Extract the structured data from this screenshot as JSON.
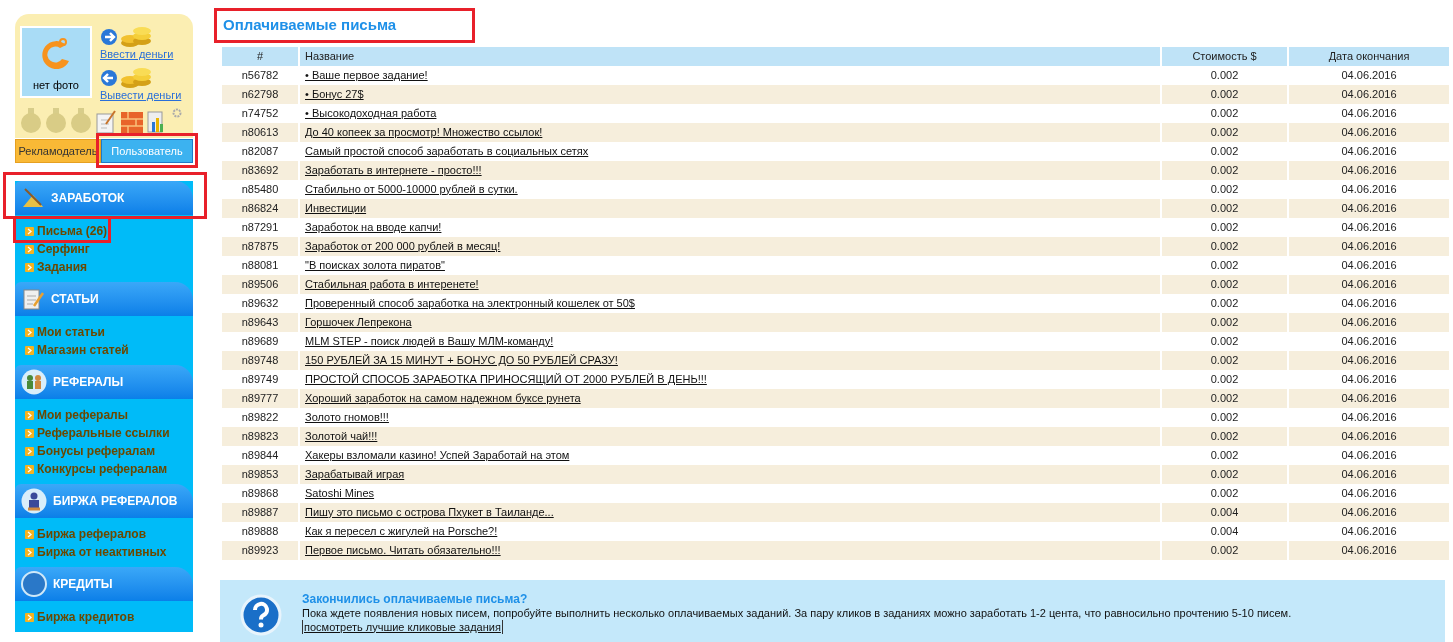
{
  "profile": {
    "photo_label": "нет фото",
    "actions": [
      {
        "kind": "deposit",
        "label": "Ввести деньги"
      },
      {
        "kind": "withdraw",
        "label": "Вывести деньги"
      }
    ],
    "modes": [
      {
        "label": "Рекламодатель",
        "selected": false,
        "highlighted": false
      },
      {
        "label": "Пользователь",
        "selected": true,
        "highlighted": true
      }
    ]
  },
  "menu": [
    {
      "kind": "earnings",
      "title": "ЗАРАБОТОК",
      "highlighted": true,
      "items": [
        {
          "label": "Письма (26)",
          "highlighted": true
        },
        {
          "label": "Серфинг",
          "highlighted": false
        },
        {
          "label": "Задания",
          "highlighted": false
        }
      ]
    },
    {
      "kind": "articles",
      "title": "СТАТЬИ",
      "highlighted": false,
      "items": [
        {
          "label": "Мои статьи",
          "highlighted": false
        },
        {
          "label": "Магазин статей",
          "highlighted": false
        }
      ]
    },
    {
      "kind": "referrals",
      "title": "РЕФЕРАЛЫ",
      "highlighted": false,
      "items": [
        {
          "label": "Мои рефералы",
          "highlighted": false
        },
        {
          "label": "Реферальные ссылки",
          "highlighted": false
        },
        {
          "label": "Бонусы рефералам",
          "highlighted": false
        },
        {
          "label": "Конкурсы рефералам",
          "highlighted": false
        }
      ]
    },
    {
      "kind": "exchange",
      "title": "БИРЖА РЕФЕРАЛОВ",
      "highlighted": false,
      "items": [
        {
          "label": "Биржа рефералов",
          "highlighted": false
        },
        {
          "label": "Биржа от неактивных",
          "highlighted": false
        }
      ]
    },
    {
      "kind": "credits",
      "title": "КРЕДИТЫ",
      "highlighted": false,
      "items": [
        {
          "label": "Биржа кредитов",
          "highlighted": false
        }
      ]
    }
  ],
  "page_title": {
    "text": "Оплачиваемые письма",
    "highlighted": true
  },
  "table": {
    "columns": [
      "#",
      "Название",
      "Стоимость $",
      "Дата окончания"
    ],
    "rows": [
      {
        "id": "n56782",
        "title": "• Ваше первое задание!",
        "cost": "0.002",
        "end_date": "04.06.2016"
      },
      {
        "id": "n62798",
        "title": "• Бонус 27$",
        "cost": "0.002",
        "end_date": "04.06.2016"
      },
      {
        "id": "n74752",
        "title": "• Высокодоходная работа",
        "cost": "0.002",
        "end_date": "04.06.2016"
      },
      {
        "id": "n80613",
        "title": "До 40 копеек за просмотр! Множество ссылок!",
        "cost": "0.002",
        "end_date": "04.06.2016"
      },
      {
        "id": "n82087",
        "title": "Самый простой способ заработать в социальных сетях",
        "cost": "0.002",
        "end_date": "04.06.2016"
      },
      {
        "id": "n83692",
        "title": "Заработать в интернете - просто!!!",
        "cost": "0.002",
        "end_date": "04.06.2016"
      },
      {
        "id": "n85480",
        "title": "Стабильно от 5000-10000 рублей в сутки.",
        "cost": "0.002",
        "end_date": "04.06.2016"
      },
      {
        "id": "n86824",
        "title": "Инвестиции",
        "cost": "0.002",
        "end_date": "04.06.2016"
      },
      {
        "id": "n87291",
        "title": "Заработок на вводе капчи!",
        "cost": "0.002",
        "end_date": "04.06.2016"
      },
      {
        "id": "n87875",
        "title": "Заработок от 200 000 рублей в месяц!",
        "cost": "0.002",
        "end_date": "04.06.2016"
      },
      {
        "id": "n88081",
        "title": "\"В поисках золота пиратов\"",
        "cost": "0.002",
        "end_date": "04.06.2016"
      },
      {
        "id": "n89506",
        "title": "Стабильная работа в интеренете!",
        "cost": "0.002",
        "end_date": "04.06.2016"
      },
      {
        "id": "n89632",
        "title": "Проверенный способ заработка на электронный кошелек от 50$",
        "cost": "0.002",
        "end_date": "04.06.2016"
      },
      {
        "id": "n89643",
        "title": "Горшочек Лепрекона",
        "cost": "0.002",
        "end_date": "04.06.2016"
      },
      {
        "id": "n89689",
        "title": "MLM STEP - поиск людей в Вашу МЛМ-команду!",
        "cost": "0.002",
        "end_date": "04.06.2016"
      },
      {
        "id": "n89748",
        "title": "150 РУБЛЕЙ ЗА 15 МИНУТ + БОНУС ДО 50 РУБЛЕЙ СРАЗУ!",
        "cost": "0.002",
        "end_date": "04.06.2016"
      },
      {
        "id": "n89749",
        "title": "ПРОСТОЙ СПОСОБ ЗАРАБОТКА ПРИНОСЯЩИЙ ОТ 2000 РУБЛЕЙ В ДЕНЬ!!!",
        "cost": "0.002",
        "end_date": "04.06.2016"
      },
      {
        "id": "n89777",
        "title": "Хороший заработок на самом надежном буксе рунета",
        "cost": "0.002",
        "end_date": "04.06.2016"
      },
      {
        "id": "n89822",
        "title": "Золото гномов!!!",
        "cost": "0.002",
        "end_date": "04.06.2016"
      },
      {
        "id": "n89823",
        "title": "Золотой чай!!!",
        "cost": "0.002",
        "end_date": "04.06.2016"
      },
      {
        "id": "n89844",
        "title": "Хакеры взломали казино! Успей Заработай на этом",
        "cost": "0.002",
        "end_date": "04.06.2016"
      },
      {
        "id": "n89853",
        "title": "Зарабатывай играя",
        "cost": "0.002",
        "end_date": "04.06.2016"
      },
      {
        "id": "n89868",
        "title": "Satoshi Mines",
        "cost": "0.002",
        "end_date": "04.06.2016"
      },
      {
        "id": "n89887",
        "title": "Пишу это письмо с острова Пхукет в Таиланде...",
        "cost": "0.004",
        "end_date": "04.06.2016"
      },
      {
        "id": "n89888",
        "title": "Как я пересел с жигулей на Porsche?!",
        "cost": "0.004",
        "end_date": "04.06.2016"
      },
      {
        "id": "n89923",
        "title": "Первое письмо. Читать обязательно!!!",
        "cost": "0.002",
        "end_date": "04.06.2016"
      }
    ]
  },
  "notice": {
    "title": "Закончились оплачиваемые письма?",
    "text": "Пока ждете появления новых писем, попробуйте выполнить несколько оплачиваемых заданий. За пару кликов в заданиях можно заработать 1-2 цента, что равносильно прочтению 5-10 писем.",
    "link": "посмотреть лучшие кликовые задания"
  }
}
